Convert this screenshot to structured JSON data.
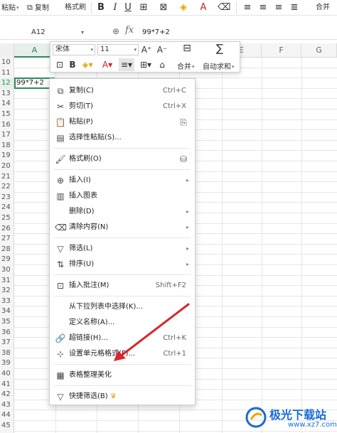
{
  "toolbar": {
    "paste": "粘贴",
    "copy": "复制",
    "format_painter": "格式刷",
    "bold": "B",
    "italic": "I",
    "underline": "U",
    "merge": "合并"
  },
  "formula_bar": {
    "cell_ref": "A12",
    "fx": "fx",
    "value": "99*7+2"
  },
  "columns": [
    "A",
    "E",
    "F",
    "G"
  ],
  "rows": [
    "10",
    "11",
    "12",
    "13",
    "14",
    "15",
    "16",
    "17",
    "18",
    "19",
    "20",
    "21",
    "22",
    "23",
    "24",
    "25",
    "26",
    "27",
    "28",
    "29",
    "30",
    "31",
    "32",
    "33",
    "34",
    "35",
    "36",
    "37",
    "38",
    "39",
    "40",
    "41",
    "42",
    "43",
    "44",
    "45",
    "46"
  ],
  "selected_cell": {
    "ref": "A12",
    "content": "99*7+2"
  },
  "mini_toolbar": {
    "font": "宋体",
    "size": "11",
    "grow": "A⁺",
    "shrink": "A⁻",
    "bold": "B",
    "merge": "合并",
    "autosum": "自动求和"
  },
  "context_menu": {
    "items": [
      {
        "label": "复制(C)",
        "shortcut": "Ctrl+C"
      },
      {
        "label": "剪切(T)",
        "shortcut": "Ctrl+X"
      },
      {
        "label": "粘贴(P)",
        "shortcut": ""
      },
      {
        "label": "选择性粘贴(S)...",
        "shortcut": ""
      },
      {
        "label": "格式刷(O)",
        "shortcut": ""
      },
      {
        "label": "插入(I)",
        "shortcut": ""
      },
      {
        "label": "插入图表",
        "shortcut": ""
      },
      {
        "label": "删除(D)",
        "shortcut": ""
      },
      {
        "label": "清除内容(N)",
        "shortcut": ""
      },
      {
        "label": "筛选(L)",
        "shortcut": ""
      },
      {
        "label": "排序(U)",
        "shortcut": ""
      },
      {
        "label": "插入批注(M)",
        "shortcut": "Shift+F2"
      },
      {
        "label": "从下拉列表中选择(K)...",
        "shortcut": ""
      },
      {
        "label": "定义名称(A)...",
        "shortcut": ""
      },
      {
        "label": "超链接(H)...",
        "shortcut": "Ctrl+K"
      },
      {
        "label": "设置单元格格式(F)...",
        "shortcut": "Ctrl+1"
      },
      {
        "label": "表格整理美化",
        "shortcut": ""
      },
      {
        "label": "快捷筛选(B)",
        "shortcut": ""
      }
    ]
  },
  "watermark": {
    "name": "极光下载站",
    "url": "www.xz7.com"
  },
  "colors": {
    "accent": "#2e8b57",
    "arrow": "#d9262c",
    "watermark": "#1a6bd8"
  }
}
